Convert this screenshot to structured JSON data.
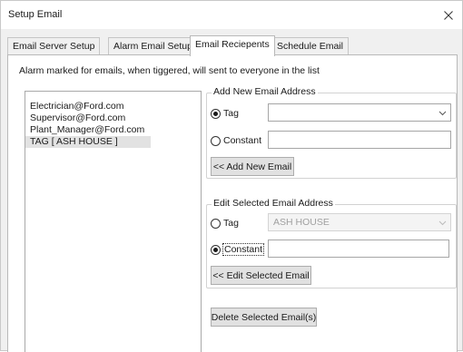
{
  "window": {
    "title": "Setup Email",
    "close_icon": "close-icon"
  },
  "tabs": [
    {
      "label": "Email Server Setup",
      "active": false
    },
    {
      "label": "Alarm Email Setup",
      "active": false
    },
    {
      "label": "Email Reciepents",
      "active": true
    },
    {
      "label": "Schedule Email",
      "active": false
    }
  ],
  "info_text": "Alarm marked for emails, when tiggered, will sent to everyone in the list",
  "recipients": [
    "Electrician@Ford.com",
    "Supervisor@Ford.com",
    "Plant_Manager@Ford.com",
    "TAG [ ASH HOUSE ]"
  ],
  "selected_recipient": "TAG [ ASH HOUSE ]",
  "add_group": {
    "legend": "Add New Email Address",
    "tag_label": "Tag",
    "constant_label": "Constant",
    "selected_option": "Tag",
    "tag_value": "",
    "constant_value": "",
    "button_label": "<< Add New Email"
  },
  "edit_group": {
    "legend": "Edit Selected Email Address",
    "tag_label": "Tag",
    "constant_label": "Constant",
    "selected_option": "Constant",
    "tag_value": "ASH HOUSE",
    "constant_value": "",
    "button_label": "<< Edit Selected Email"
  },
  "delete_button_label": "Delete Selected Email(s)"
}
